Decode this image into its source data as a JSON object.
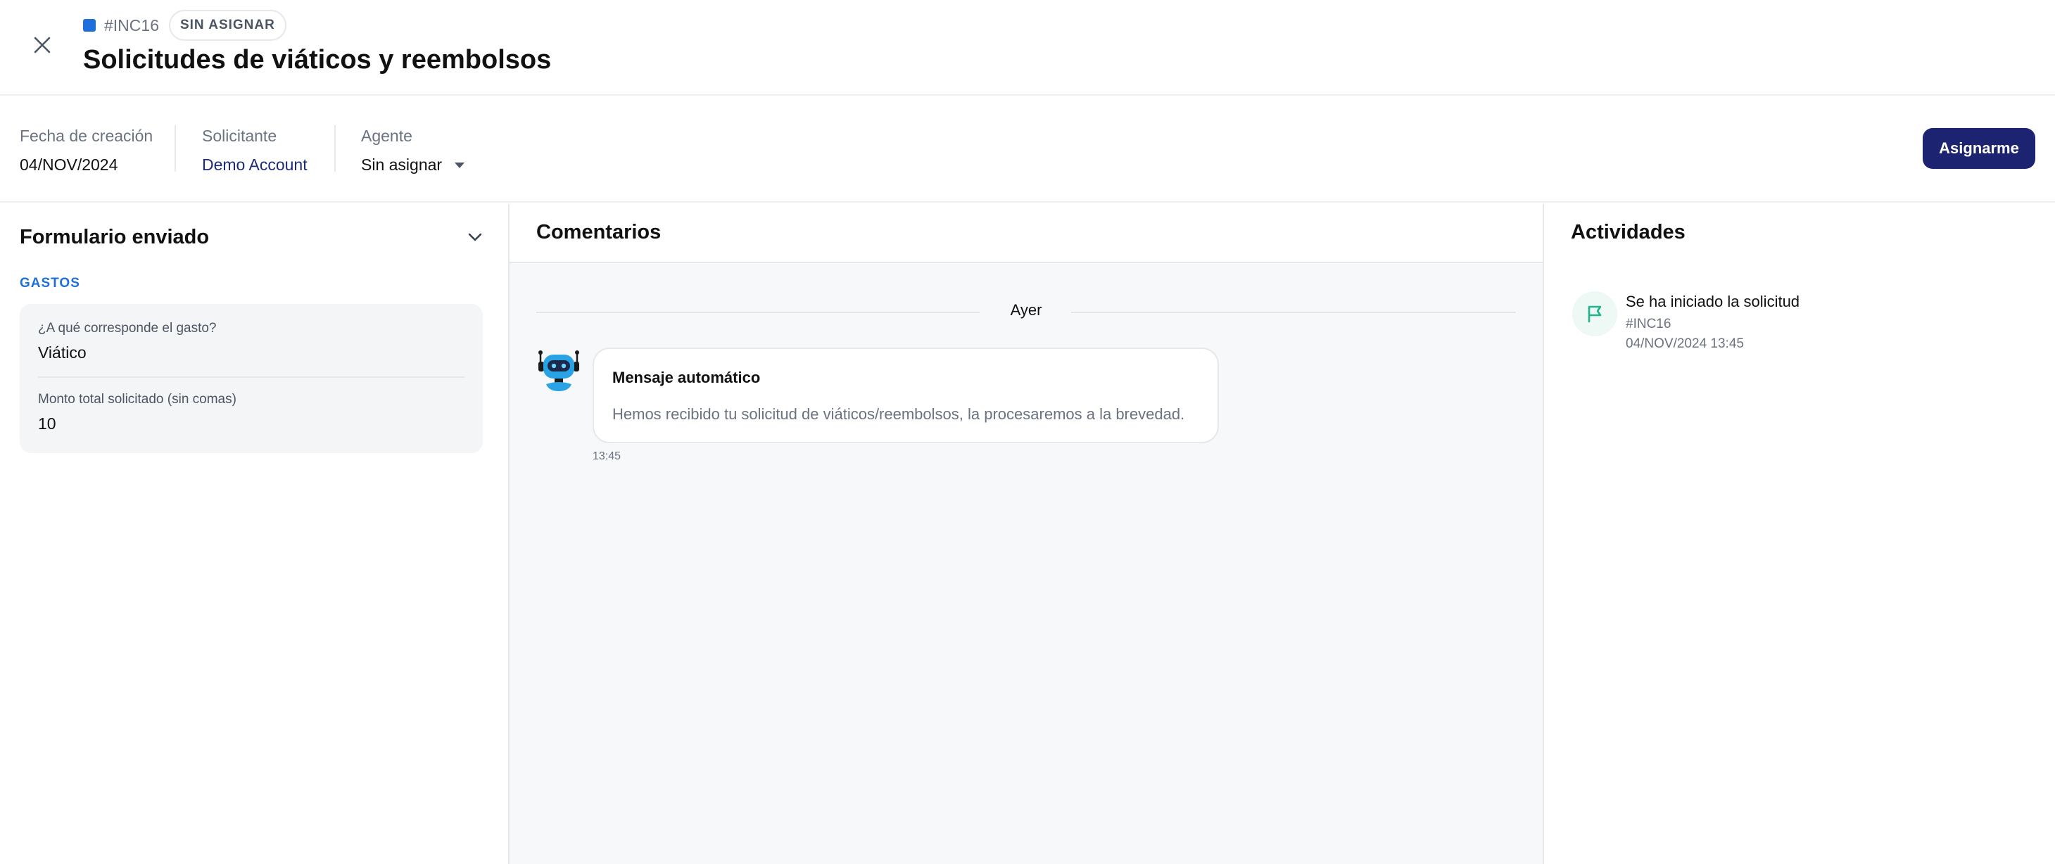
{
  "ticket": {
    "id": "#INC16",
    "status_badge": "SIN ASIGNAR",
    "title": "Solicitudes de viáticos y reembolsos"
  },
  "info": {
    "created_label": "Fecha de creación",
    "created_value": "04/NOV/2024",
    "requester_label": "Solicitante",
    "requester_value": "Demo Account",
    "agent_label": "Agente",
    "agent_value": "Sin asignar",
    "assign_button": "Asignarme"
  },
  "form": {
    "title": "Formulario enviado",
    "section": "GASTOS",
    "fields": [
      {
        "question": "¿A qué corresponde el gasto?",
        "answer": "Viático"
      },
      {
        "question": "Monto total solicitado (sin comas)",
        "answer": "10"
      }
    ]
  },
  "comments": {
    "title": "Comentarios",
    "day_separator": "Ayer",
    "messages": [
      {
        "title": "Mensaje automático",
        "body": "Hemos recibido tu solicitud de viáticos/reembolsos, la procesaremos a la brevedad.",
        "time": "13:45"
      }
    ]
  },
  "activities": {
    "title": "Actividades",
    "items": [
      {
        "text": "Se ha iniciado la solicitud",
        "ref": "#INC16",
        "date": "04/NOV/2024 13:45"
      }
    ]
  },
  "colors": {
    "accent_blue": "#1e6fd9",
    "primary_button": "#1c2370",
    "activity_green": "#1fb58a"
  },
  "icons": [
    "close-icon",
    "chevron-down-icon",
    "caret-down-icon",
    "bot-avatar-icon",
    "flag-icon"
  ]
}
